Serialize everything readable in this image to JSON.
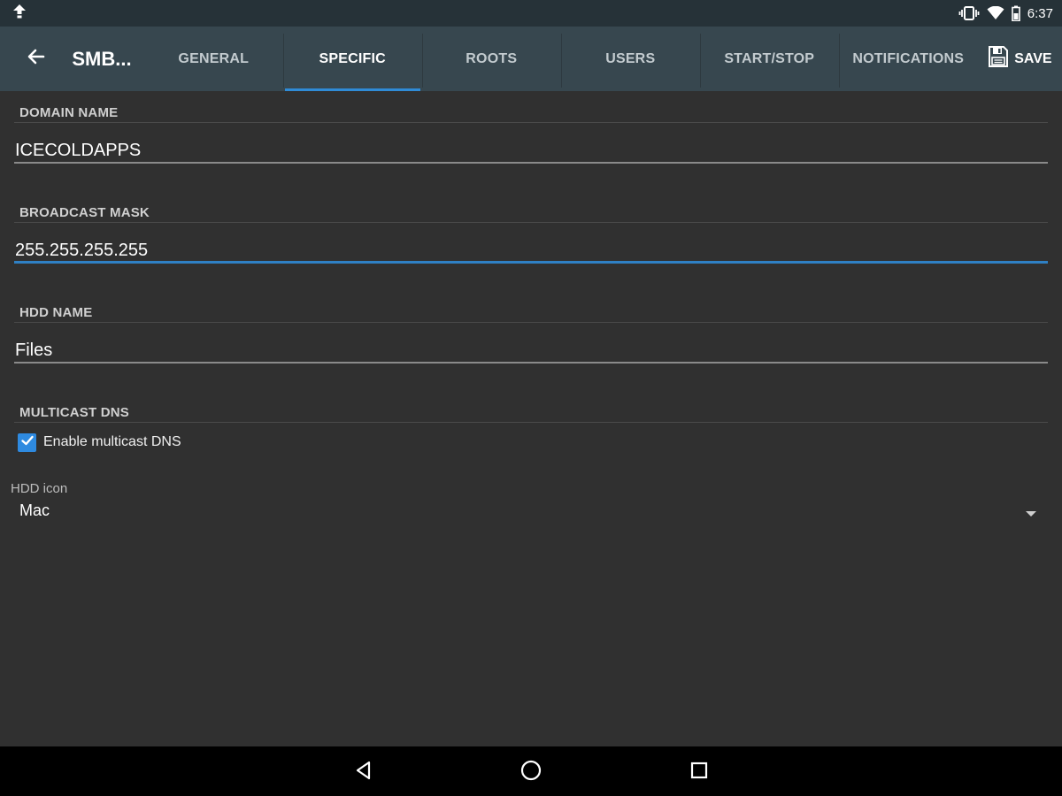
{
  "status_bar": {
    "time": "6:37",
    "left_icon": "upload-arrow-icon",
    "icons": [
      "vibrate-icon",
      "wifi-icon",
      "battery-icon"
    ]
  },
  "app_bar": {
    "back_icon": "arrow-left-icon",
    "title": "SMB...",
    "tabs": [
      {
        "label": "GENERAL"
      },
      {
        "label": "SPECIFIC",
        "active": true
      },
      {
        "label": "ROOTS"
      },
      {
        "label": "USERS"
      },
      {
        "label": "START/STOP"
      },
      {
        "label": "NOTIFICATIONS"
      }
    ],
    "save": {
      "label": "SAVE",
      "icon": "floppy-disk-icon"
    }
  },
  "form": {
    "domain_name": {
      "header": "DOMAIN NAME",
      "value": "ICECOLDAPPS"
    },
    "broadcast_mask": {
      "header": "BROADCAST MASK",
      "value": "255.255.255.255"
    },
    "hdd_name": {
      "header": "HDD NAME",
      "value": "Files"
    },
    "multicast_dns": {
      "header": "MULTICAST DNS",
      "checkbox_label": "Enable multicast DNS",
      "checked": true
    },
    "hdd_icon": {
      "label": "HDD icon",
      "selected": "Mac"
    }
  },
  "nav_bar": {
    "icons": [
      "back-triangle-icon",
      "home-circle-icon",
      "recents-square-icon"
    ]
  },
  "colors": {
    "accent": "#2f8bd6",
    "app_bar": "#37474f",
    "status_bar": "#263238",
    "background": "#303030"
  }
}
